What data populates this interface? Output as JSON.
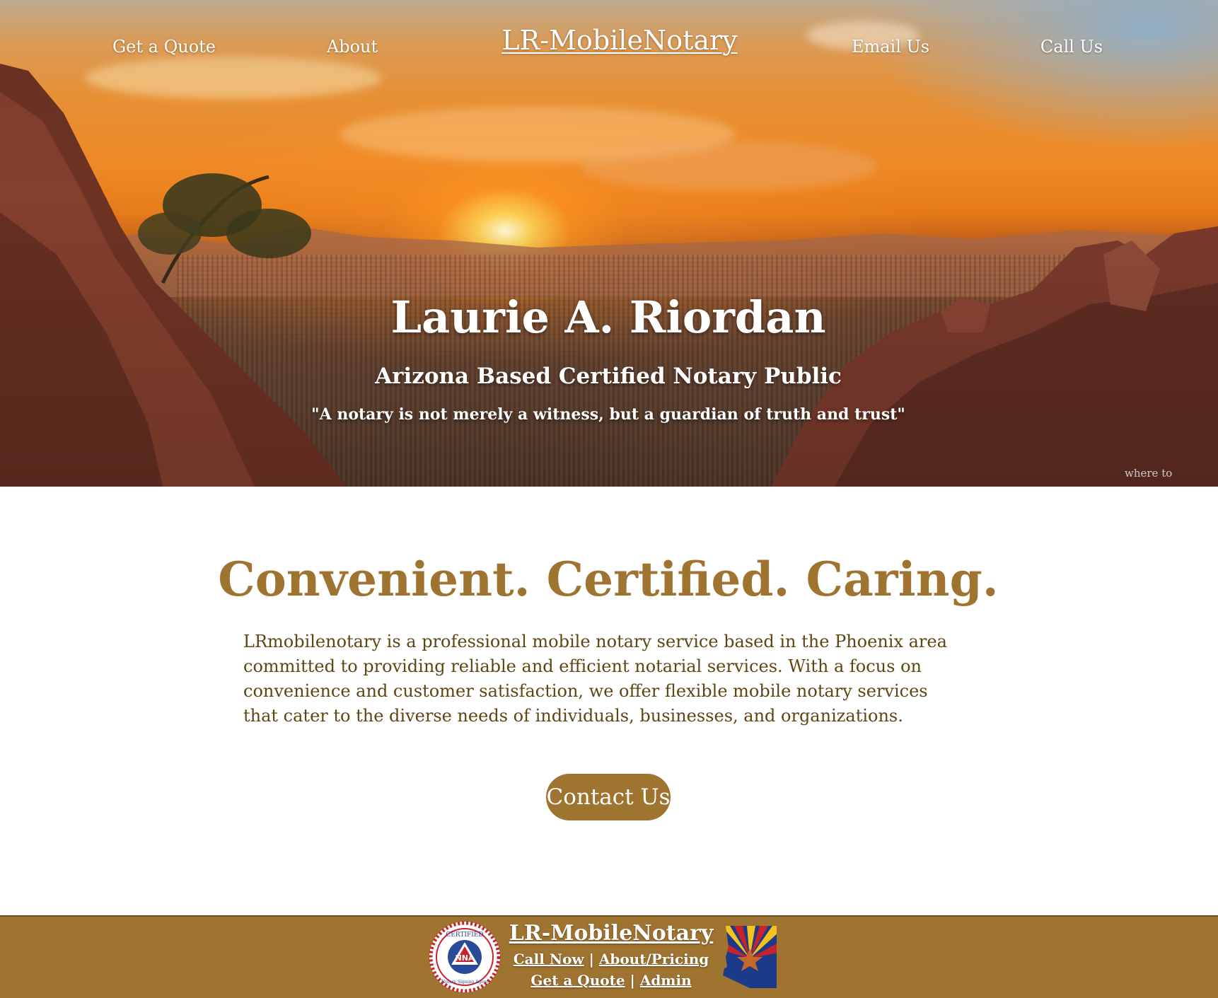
{
  "colors": {
    "accent": "#9f7330",
    "body_text": "#5e4512",
    "hero_text": "#ffffff"
  },
  "nav": {
    "brand": "LR-MobileNotary",
    "items": [
      {
        "label": "Get a Quote"
      },
      {
        "label": "About"
      },
      {
        "label": "Email Us"
      },
      {
        "label": "Call Us"
      }
    ]
  },
  "hero": {
    "name": "Laurie A. Riordan",
    "subtitle": "Arizona Based Certified Notary Public",
    "quote": "\"A notary is not merely a witness, but a guardian of truth and trust\"",
    "watermark": "where to"
  },
  "main": {
    "tagline": "Convenient. Certified. Caring.",
    "intro": "LRmobilenotary is a professional mobile notary service based in the Phoenix area committed to providing reliable and efficient notarial services. With a focus on convenience and customer satisfaction, we offer flexible mobile notary services that cater to the diverse needs of individuals, businesses, and organizations.",
    "cta_label": "Contact Us"
  },
  "footer": {
    "brand": "LR-MobileNotary",
    "links_row1": [
      "Call Now",
      "About/Pricing"
    ],
    "links_row2": [
      "Get a Quote",
      "Admin"
    ],
    "separator": "|",
    "seal": {
      "icon": "nna-certified-seal-icon",
      "text_top": "CERTIFIED",
      "text_center": "NNA",
      "text_bottom": "Notary Signing Agent"
    },
    "state_icon": "arizona-flag-state-icon"
  }
}
